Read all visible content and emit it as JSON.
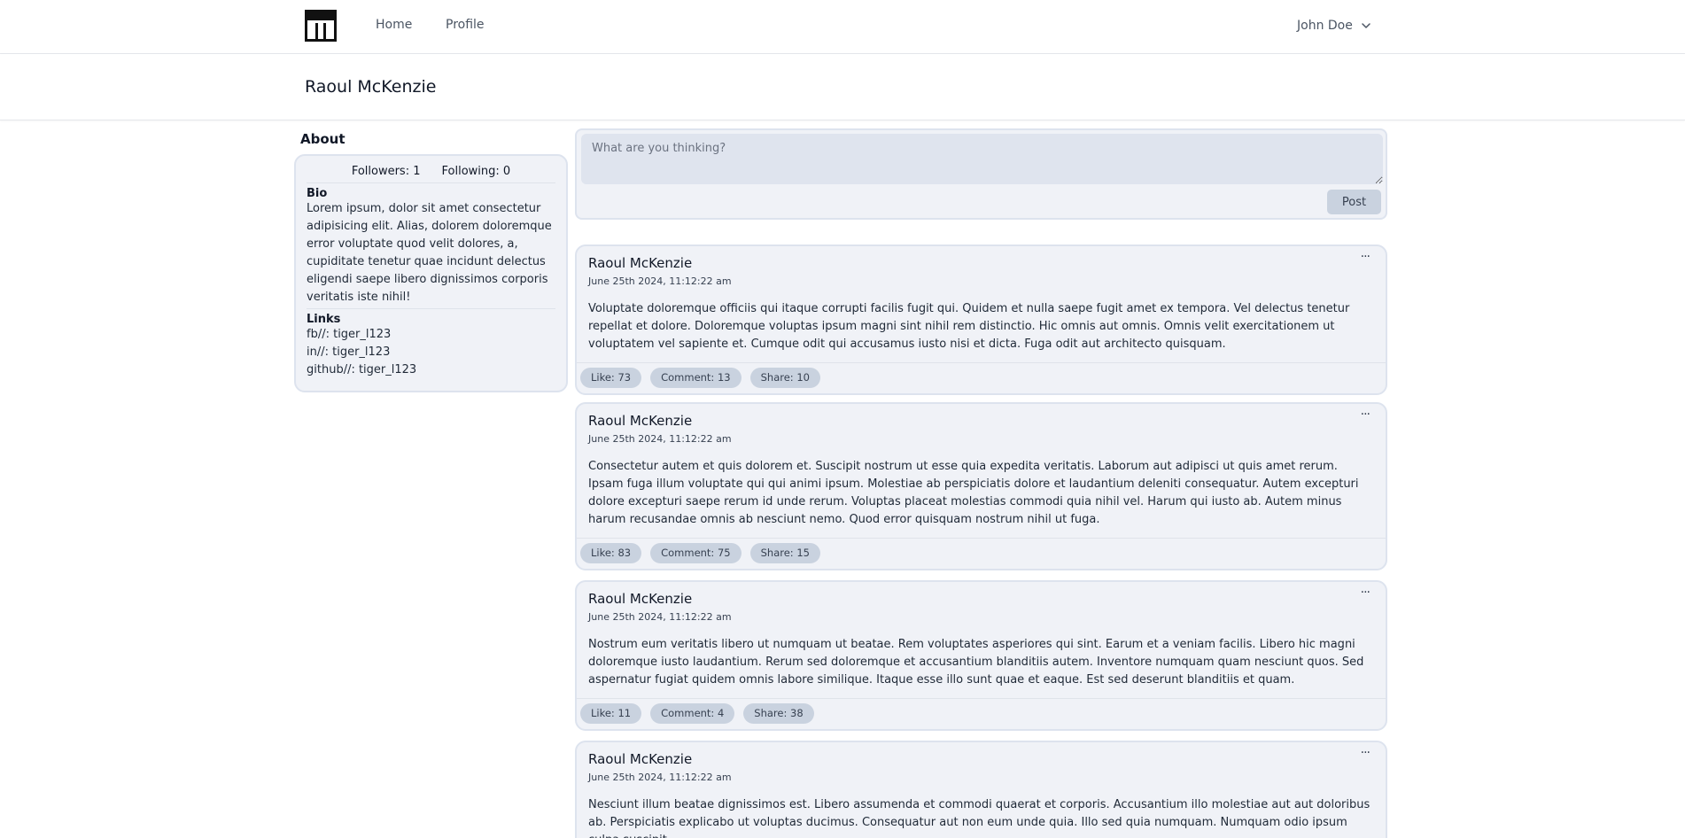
{
  "nav": {
    "home_label": "Home",
    "profile_label": "Profile",
    "user_name": "John Doe"
  },
  "page": {
    "title": "Raoul McKenzie"
  },
  "about": {
    "heading": "About",
    "followers_label": "Followers: 1",
    "following_label": "Following: 0",
    "bio_title": "Bio",
    "bio_text": "Lorem ipsum, dolor sit amet consectetur adipisicing elit. Alias, dolorem doloremque error voluptate quod velit dolores, a, cupiditate tenetur quae incidunt delectus eligendi saepe libero dignissimos corporis veritatis iste nihil!",
    "links_title": "Links",
    "links": [
      "fb//: tiger_l123",
      "in//: tiger_l123",
      "github//: tiger_l123"
    ]
  },
  "composer": {
    "placeholder": "What are you thinking?",
    "post_label": "Post"
  },
  "posts": [
    {
      "author": "Raoul McKenzie",
      "date": "June 25th 2024, 11:12:22 am",
      "text": "Voluptate doloremque officiis qui itaque corrupti facilis fugit qui. Quidem et nulla saepe fugit amet ex tempora. Vel delectus tenetur repellat et dolore. Doloremque voluptas ipsum magni sint nihil rem distinctio. Hic omnis aut omnis. Omnis velit exercitationem ut voluptatem vel sapiente et. Cumque odit qui accusamus iusto nisi et dicta. Fuga odit aut architecto quisquam.",
      "like": "Like: 73",
      "comment": "Comment: 13",
      "share": "Share: 10",
      "menu": "..."
    },
    {
      "author": "Raoul McKenzie",
      "date": "June 25th 2024, 11:12:22 am",
      "text": "Consectetur autem et quis dolorem et. Suscipit nostrum ut esse quia expedita veritatis. Laborum aut adipisci ut quis amet rerum. Ipsam fuga illum voluptate qui qui animi ipsum. Molestiae ab perspiciatis dolore et laudantium deleniti consequatur. Autem excepturi dolore excepturi saepe rerum id unde rerum. Voluptas placeat molestias commodi quia nihil vel. Harum qui iusto ab. Autem minus harum recusandae omnis ab nesciunt nemo. Quod error quisquam nostrum nihil ut fuga.",
      "like": "Like: 83",
      "comment": "Comment: 75",
      "share": "Share: 15",
      "menu": "..."
    },
    {
      "author": "Raoul McKenzie",
      "date": "June 25th 2024, 11:12:22 am",
      "text": "Nostrum eum veritatis libero ut numquam ut beatae. Rem voluptates asperiores qui sint. Earum et a veniam facilis. Libero hic magni doloremque iusto laudantium. Rerum sed doloremque et accusantium blanditiis autem. Inventore numquam quam nesciunt quos. Sed aspernatur fugiat quidem omnis labore similique. Itaque esse illo sunt quae et eaque. Est sed deserunt blanditiis et quam.",
      "like": "Like: 11",
      "comment": "Comment: 4",
      "share": "Share: 38",
      "menu": "..."
    },
    {
      "author": "Raoul McKenzie",
      "date": "June 25th 2024, 11:12:22 am",
      "text": "Nesciunt illum beatae dignissimos est. Libero assumenda et commodi quaerat et corporis. Accusantium illo molestiae aut aut doloribus ab. Perspiciatis explicabo ut voluptas ducimus. Consequatur aut non eum unde quia. Illo sed quia numquam. Numquam odio ipsum culpa suscipit",
      "menu": "..."
    }
  ]
}
